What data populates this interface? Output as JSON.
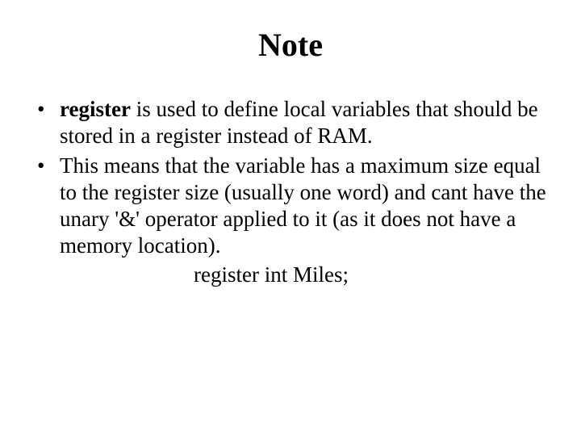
{
  "title": "Note",
  "bullets": [
    {
      "keyword": "register",
      "rest": " is used to define local variables that should be stored in a register instead of RAM."
    },
    {
      "keyword": "",
      "rest": " This means that the variable has a maximum size equal to the register size (usually one word) and cant have the unary '&' operator applied to it (as it does not have a memory location)."
    }
  ],
  "code_line": "register int Miles;"
}
